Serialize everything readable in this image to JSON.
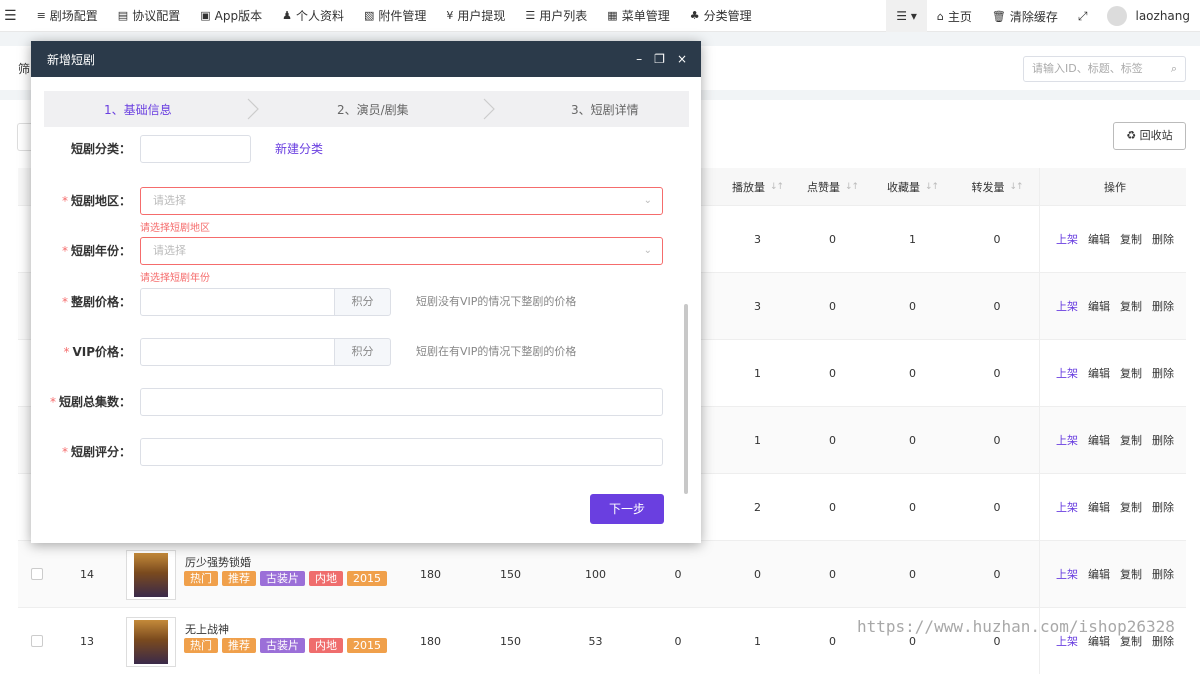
{
  "topnav": {
    "menu_icon": "hamburger-icon",
    "items": [
      {
        "icon": "≡",
        "label": "剧场配置"
      },
      {
        "icon": "▤",
        "label": "协议配置"
      },
      {
        "icon": "▣",
        "label": "App版本"
      },
      {
        "icon": "♟",
        "label": "个人资料"
      },
      {
        "icon": "▧",
        "label": "附件管理"
      },
      {
        "icon": "¥",
        "label": "用户提现"
      },
      {
        "icon": "☰",
        "label": "用户列表"
      },
      {
        "icon": "▦",
        "label": "菜单管理"
      },
      {
        "icon": "♣",
        "label": "分类管理"
      }
    ],
    "right": {
      "more_icon": "list-dropdown-icon",
      "home": "主页",
      "clear_cache": "清除缓存",
      "fullscreen_icon": "expand-icon",
      "username": "laozhang"
    }
  },
  "filterbar": {
    "label": "筛",
    "search_placeholder": "请输入ID、标题、标签"
  },
  "main": {
    "recycle_label": "回收站",
    "columns": [
      "播放量",
      "点赞量",
      "收藏量",
      "转发量",
      "操作"
    ],
    "ops": [
      "上架",
      "编辑",
      "复制",
      "删除"
    ],
    "rows": [
      {
        "plays": "3",
        "likes": "0",
        "favs": "1",
        "shares": "0"
      },
      {
        "plays": "3",
        "likes": "0",
        "favs": "0",
        "shares": "0"
      },
      {
        "plays": "1",
        "likes": "0",
        "favs": "0",
        "shares": "0"
      },
      {
        "plays": "1",
        "likes": "0",
        "favs": "0",
        "shares": "0"
      },
      {
        "plays": "2",
        "likes": "0",
        "favs": "0",
        "shares": "0"
      },
      {
        "id": "14",
        "title": "厉少强势锁婚",
        "tags": [
          "热门",
          "推荐",
          "古装片",
          "内地",
          "2015"
        ],
        "c1": "180",
        "c2": "150",
        "c3": "100",
        "c4": "0",
        "plays": "0",
        "likes": "0",
        "favs": "0",
        "shares": "0"
      },
      {
        "id": "13",
        "title": "无上战神",
        "tags": [
          "热门",
          "推荐",
          "古装片",
          "内地",
          "2015"
        ],
        "c1": "180",
        "c2": "150",
        "c3": "53",
        "c4": "0",
        "plays": "1",
        "likes": "0",
        "favs": "0",
        "shares": "0"
      }
    ]
  },
  "watermark": "https://www.huzhan.com/ishop26328",
  "modal": {
    "title": "新增短剧",
    "controls": [
      "–",
      "❐",
      "×"
    ],
    "steps": [
      "1、基础信息",
      "2、演员/剧集",
      "3、短剧详情"
    ],
    "fields": {
      "category": {
        "label": "短剧分类：",
        "link": "新建分类"
      },
      "region": {
        "label": "短剧地区：",
        "placeholder": "请选择",
        "error": "请选择短剧地区"
      },
      "year": {
        "label": "短剧年份：",
        "placeholder": "请选择",
        "error": "请选择短剧年份"
      },
      "price": {
        "label": "整剧价格：",
        "suffix": "积分",
        "hint": "短剧没有VIP的情况下整剧的价格"
      },
      "vip_price": {
        "label": "VIP价格：",
        "suffix": "积分",
        "hint": "短剧在有VIP的情况下整剧的价格"
      },
      "episodes": {
        "label": "短剧总集数："
      },
      "rating": {
        "label": "短剧评分："
      }
    },
    "next_button": "下一步"
  }
}
